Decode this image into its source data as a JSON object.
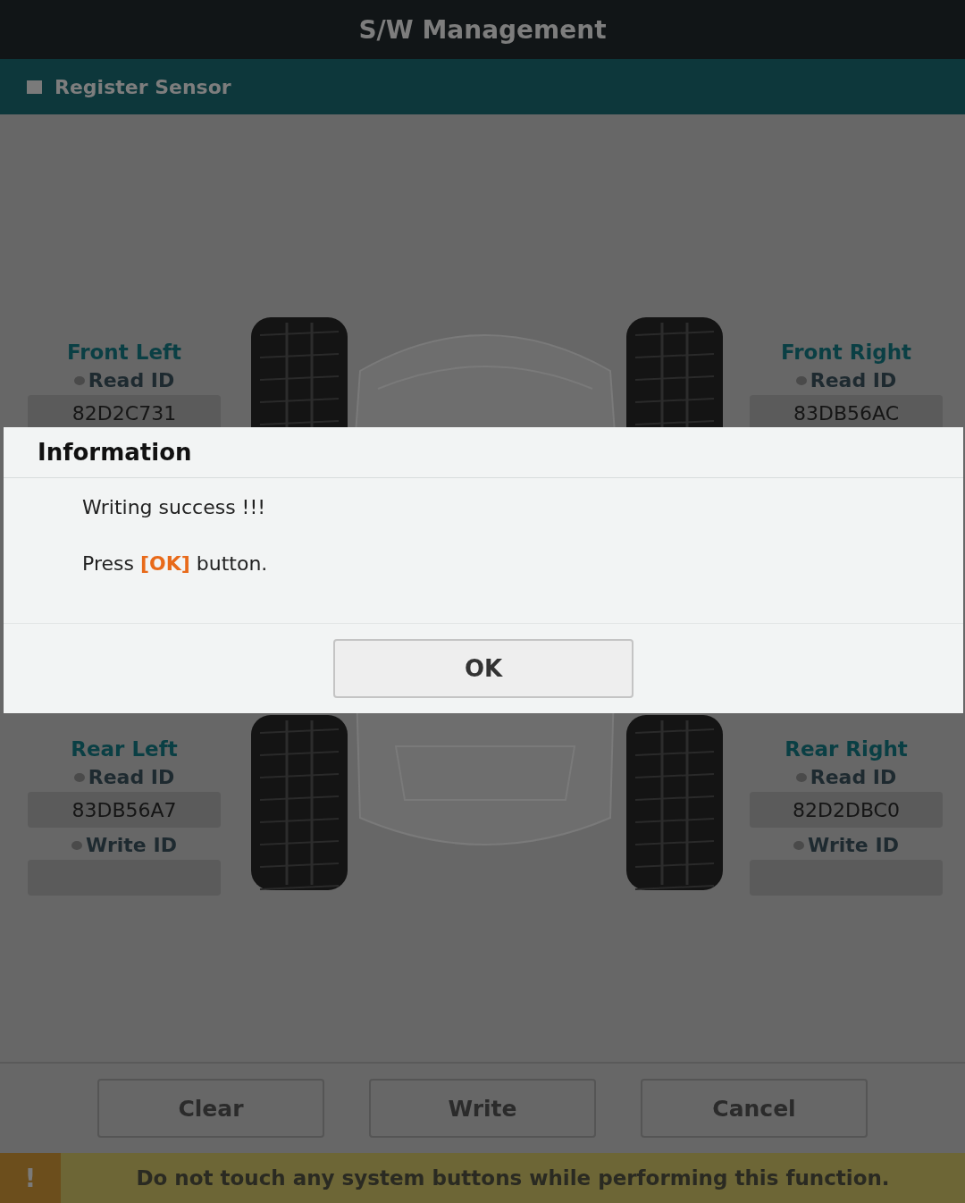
{
  "window": {
    "title": "S/W Management"
  },
  "section": {
    "title": "Register Sensor"
  },
  "sensors": [
    {
      "position": "Front Left",
      "fields": [
        {
          "label": "Read ID",
          "value": "82D2C731"
        }
      ]
    },
    {
      "position": "Front Right",
      "fields": [
        {
          "label": "Read ID",
          "value": "83DB56AC"
        }
      ]
    },
    {
      "position": "Rear Left",
      "fields": [
        {
          "label": "Read ID",
          "value": "83DB56A7"
        },
        {
          "label": "Write ID"
        }
      ]
    },
    {
      "position": "Rear Right",
      "fields": [
        {
          "label": "Read ID",
          "value": "82D2DBC0"
        },
        {
          "label": "Write ID"
        }
      ]
    }
  ],
  "dialog": {
    "title": "Information",
    "message": "Writing success !!!",
    "prompt": {
      "before": "Press ",
      "highlight": "[OK]",
      "after": " button."
    },
    "button": "OK"
  },
  "buttons": [
    "Clear",
    "Write",
    "Cancel"
  ],
  "warning": {
    "icon": "!",
    "text": "Do not touch any system buttons while performing this function."
  }
}
